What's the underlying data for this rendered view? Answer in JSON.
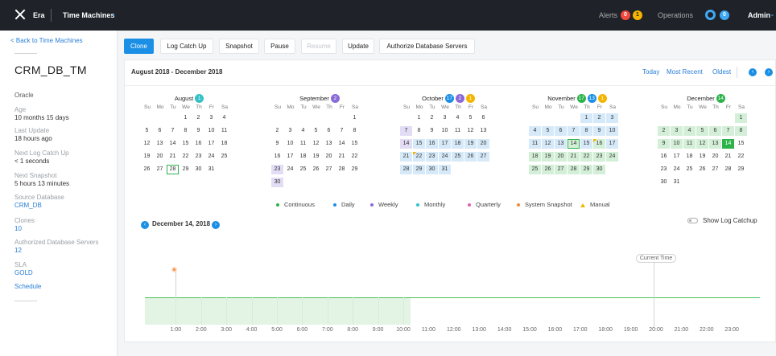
{
  "topbar": {
    "app_name": "Era",
    "section": "Time Machines",
    "alerts_label": "Alerts",
    "alerts_count_red": "0",
    "alerts_count_yellow": "1",
    "operations_label": "Operations",
    "operations_count": "0",
    "user": "Admin",
    "colors": {
      "red": "#f0493e",
      "yellow": "#f5b400",
      "blue": "#3fa9f5"
    }
  },
  "sidebar": {
    "back_link": "< Back to Time Machines",
    "title": "CRM_DB_TM",
    "engine": "Oracle",
    "fields": [
      {
        "label": "Age",
        "value": "10 months 15 days"
      },
      {
        "label": "Last Update",
        "value": "18 hours ago"
      },
      {
        "label": "Next Log Catch Up",
        "value": "< 1 seconds"
      },
      {
        "label": "Next Snapshot",
        "value": "5 hours 13 minutes"
      },
      {
        "label": "Source Database",
        "value": "CRM_DB"
      },
      {
        "label": "Clones",
        "value": "10"
      },
      {
        "label": "Authorized Database Servers",
        "value": "12"
      },
      {
        "label": "SLA",
        "value": "GOLD"
      }
    ],
    "schedule_link": "Schedule"
  },
  "toolbar": {
    "clone": "Clone",
    "log_catch_up": "Log Catch Up",
    "snapshot": "Snapshot",
    "pause": "Pause",
    "resume": "Resume",
    "update": "Update",
    "authorize": "Authorize Database Servers"
  },
  "calendar": {
    "range_title": "August 2018 - December 2018",
    "nav": {
      "today": "Today",
      "most_recent": "Most Recent",
      "oldest": "Oldest"
    },
    "weekdays": [
      "Su",
      "Mo",
      "Tu",
      "We",
      "Th",
      "Fr",
      "Sa"
    ],
    "months": [
      {
        "name": "August",
        "badges": [
          {
            "count": "1",
            "color": "#36c1c8"
          }
        ],
        "start": 3,
        "days": 31,
        "blue": [],
        "purple": [],
        "green": [],
        "outlined": [
          28
        ]
      },
      {
        "name": "September",
        "badges": [
          {
            "count": "2",
            "color": "#8a6ad6"
          }
        ],
        "start": 6,
        "days": 30,
        "blue": [],
        "purple": [
          23,
          30
        ],
        "green": [],
        "outlined": []
      },
      {
        "name": "October",
        "badges": [
          {
            "count": "17",
            "color": "#1b8fe5"
          },
          {
            "count": "2",
            "color": "#8a6ad6"
          },
          {
            "count": "1",
            "color": "#f5b400"
          }
        ],
        "start": 1,
        "days": 31,
        "blue": [
          14,
          15,
          16,
          17,
          18,
          19,
          20,
          21,
          22,
          23,
          24,
          25,
          26,
          27,
          28,
          29,
          30,
          31
        ],
        "purple": [
          7,
          14
        ],
        "green": [],
        "outlined": [],
        "manual": [
          22
        ]
      },
      {
        "name": "November",
        "badges": [
          {
            "count": "17",
            "color": "#2db34a"
          },
          {
            "count": "13",
            "color": "#1b8fe5"
          },
          {
            "count": "1",
            "color": "#f5b400"
          }
        ],
        "start": 4,
        "days": 30,
        "blue": [
          1,
          2,
          3,
          4,
          5,
          6,
          7,
          8,
          9,
          10,
          11,
          12,
          13,
          15,
          17
        ],
        "purple": [],
        "green": [
          14,
          16,
          18,
          19,
          20,
          21,
          22,
          23,
          24,
          25,
          26,
          27,
          28,
          29,
          30
        ],
        "outlined": [
          14
        ],
        "manual": [
          16
        ]
      },
      {
        "name": "December",
        "badges": [
          {
            "count": "14",
            "color": "#2db34a"
          }
        ],
        "start": 6,
        "days": 31,
        "blue": [],
        "purple": [],
        "green": [
          1,
          2,
          3,
          4,
          5,
          6,
          7,
          8,
          9,
          10,
          11,
          12,
          13,
          14
        ],
        "outlined": [],
        "selected": [
          14
        ]
      }
    ],
    "legend": [
      {
        "label": "Continuous",
        "color": "#2db34a",
        "shape": "dot"
      },
      {
        "label": "Daily",
        "color": "#1b8fe5",
        "shape": "dot"
      },
      {
        "label": "Weekly",
        "color": "#8a6ad6",
        "shape": "dot"
      },
      {
        "label": "Monthly",
        "color": "#36c1c8",
        "shape": "dot"
      },
      {
        "label": "Quarterly",
        "color": "#e35fb0",
        "shape": "dot"
      },
      {
        "label": "System Snapshot",
        "color": "#f08a3b",
        "shape": "dot"
      },
      {
        "label": "Manual",
        "color": "#f5b400",
        "shape": "triangle"
      }
    ]
  },
  "timeline": {
    "date": "December 14, 2018",
    "show_log_catchup": "Show Log Catchup",
    "current_time_label": "Current Time",
    "ticks": [
      "1:00",
      "2:00",
      "3:00",
      "4:00",
      "5:00",
      "6:00",
      "7:00",
      "8:00",
      "9:00",
      "10:00",
      "11:00",
      "12:00",
      "13:00",
      "14:00",
      "15:00",
      "16:00",
      "17:00",
      "18:00",
      "19:00",
      "20:00",
      "21:00",
      "22:00",
      "23:00"
    ],
    "continuous_until_hour": 10.3,
    "snapshot_hour": 1.0,
    "current_time_hour": 19.9
  }
}
